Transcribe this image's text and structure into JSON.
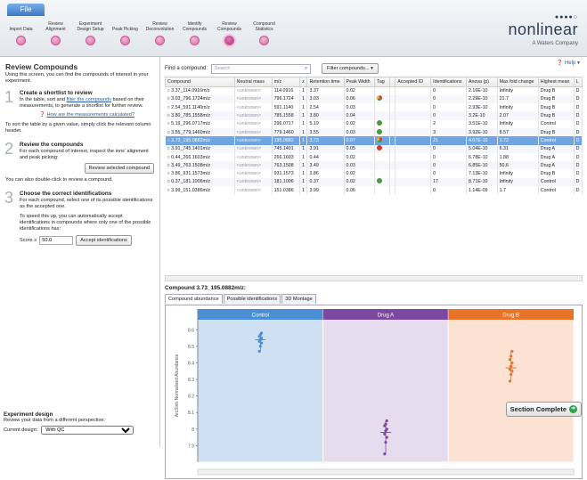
{
  "file_tab": "File",
  "steps": [
    {
      "label": "Import Data",
      "active": false
    },
    {
      "label": "Review Alignment",
      "active": false
    },
    {
      "label": "Experiment Design Setup",
      "active": false
    },
    {
      "label": "Peak Picking",
      "active": false
    },
    {
      "label": "Review Deconvolution",
      "active": false
    },
    {
      "label": "Identify Compounds",
      "active": false
    },
    {
      "label": "Review Compounds",
      "active": true
    },
    {
      "label": "Compound Statistics",
      "active": false
    }
  ],
  "logo": {
    "brand": "nonlinear",
    "sub": "A Waters Company"
  },
  "help": "Help",
  "left": {
    "title": "Review Compounds",
    "intro": "Using this screen, you can find the compounds of interest in your experiment.",
    "step1": {
      "num": "1",
      "title": "Create a shortlist to review",
      "t1": "In the table, sort and ",
      "link": "filter the compounds",
      "t2": " based on their measurements, to generate a shortlist for further review.",
      "question": "How are the measurements calculated?",
      "sort": "To sort the table by a given value, simply click the relevant column header."
    },
    "step2": {
      "num": "2",
      "title": "Review the compounds",
      "text": "For each compound of interest, inspect the ions' alignment and peak picking:",
      "button": "Review selected compound",
      "dbl": "You can also double-click to review a compound."
    },
    "step3": {
      "num": "3",
      "title": "Choose the correct identifications",
      "text": "For each compound, select one of its possible identifications as the accepted one.",
      "speed": "To speed this up, you can automatically accept identifications in compounds where only one of the possible identifications has:",
      "score_label": "Score ≥",
      "score_value": "50.0",
      "accept_button": "Accept identifications"
    },
    "design": {
      "title": "Experiment design",
      "text": "Review your data from a different perspective:",
      "label": "Current design:",
      "value": "With QC"
    }
  },
  "toolbar": {
    "find_label": "Find a compound:",
    "search_placeholder": "Search",
    "filter_button": "Filter compounds..."
  },
  "table": {
    "headers": [
      "Compound",
      "Neutral mass",
      "m/z",
      "z",
      "Retention time",
      "Peak Width",
      "Tag",
      "",
      "Accepted ID",
      "Identifications",
      "Anova (p)",
      "Max fold change",
      "Highest mean",
      "L"
    ],
    "rows": [
      [
        "3.37_114.0916m/z",
        "<unknown>",
        "114.0916",
        "1",
        "3.37",
        "0.02",
        "",
        "",
        "",
        "0",
        "2.16E-10",
        "Infinity",
        "Drug B",
        "D"
      ],
      [
        "3.03_796.1724m/z",
        "<unknown>",
        "796.1724",
        "1",
        "3.03",
        "0.06",
        "multi",
        "",
        "",
        "0",
        "2.29E-10",
        "21.7",
        "Drug B",
        "D"
      ],
      [
        "2.54_591.1140m/z",
        "<unknown>",
        "591.1140",
        "1",
        "2.54",
        "0.03",
        "",
        "",
        "",
        "0",
        "2.93E-10",
        "Infinity",
        "Drug B",
        "D"
      ],
      [
        "3.80_785.1558m/z",
        "<unknown>",
        "785.1558",
        "1",
        "3.80",
        "0.04",
        "",
        "",
        "",
        "0",
        "3.2E-10",
        "2.07",
        "Drug B",
        "D"
      ],
      [
        "5.19_296.0717m/z",
        "<unknown>",
        "296.0717",
        "1",
        "5.19",
        "0.02",
        "green",
        "",
        "",
        "2",
        "3.51E-10",
        "Infinity",
        "Control",
        "D"
      ],
      [
        "3.55_779.1460m/z",
        "<unknown>",
        "779.1460",
        "1",
        "3.55",
        "0.03",
        "green",
        "",
        "",
        "3",
        "3.92E-10",
        "8.57",
        "Drug B",
        "D"
      ],
      [
        "3.73_195.0882m/z",
        "<unknown>",
        "195.0882",
        "1",
        "3.73",
        "0.07",
        "multi",
        "",
        "",
        "21",
        "4.07E-10",
        "1.72",
        "Control",
        "D"
      ],
      [
        "3.91_745.1401m/z",
        "<unknown>",
        "745.1401",
        "1",
        "3.91",
        "0.05",
        "red",
        "",
        "",
        "0",
        "5.04E-10",
        "6.31",
        "Drug A",
        "D"
      ],
      [
        "0.44_266.1603m/z",
        "<unknown>",
        "266.1603",
        "1",
        "0.44",
        "0.02",
        "",
        "",
        "",
        "0",
        "6.78E-10",
        "1.88",
        "Drug A",
        "D"
      ],
      [
        "3.49_763.1508m/z",
        "<unknown>",
        "763.1508",
        "1",
        "3.49",
        "0.03",
        "",
        "",
        "",
        "0",
        "6.85E-10",
        "50.6",
        "Drug A",
        "D"
      ],
      [
        "3.86_931.1573m/z",
        "<unknown>",
        "931.1573",
        "1",
        "3.86",
        "0.02",
        "",
        "",
        "",
        "0",
        "7.13E-10",
        "Infinity",
        "Drug B",
        "D"
      ],
      [
        "0.37_181.1006m/z",
        "<unknown>",
        "181.1006",
        "1",
        "0.37",
        "0.02",
        "green",
        "",
        "",
        "17",
        "8.71E-10",
        "Infinity",
        "Control",
        "D"
      ],
      [
        "3.99_151.0386m/z",
        "<unknown>",
        "151.0386",
        "1",
        "3.99",
        "0.06",
        "",
        "",
        "",
        "0",
        "1.14E-09",
        "1.7",
        "Control",
        "D"
      ]
    ],
    "selected_index": 6
  },
  "detail": {
    "title": "Compound 3.73_195.0882m/z:",
    "tabs": [
      "Compound abundance",
      "Possible identifications",
      "3D Montage"
    ]
  },
  "colors": {
    "control": "#4a8fd3",
    "druga": "#7b4aa0",
    "drugb": "#e8742a",
    "selected": "#6fa5e0",
    "tag_red": "#d93a2b",
    "tag_green": "#4a9a3a"
  },
  "chart_data": {
    "type": "scatter",
    "ylabel": "ArcSinh Normalised Abundance",
    "ylim": [
      7.8,
      8.65
    ],
    "yticks": [
      7.9,
      8.0,
      8.1,
      8.2,
      8.3,
      8.4,
      8.5,
      8.6
    ],
    "groups": [
      {
        "name": "Control",
        "values": [
          8.47,
          8.5,
          8.52,
          8.53,
          8.54,
          8.55,
          8.56,
          8.57,
          8.58
        ],
        "mean": 8.54
      },
      {
        "name": "Drug A",
        "values": [
          7.85,
          7.92,
          7.95,
          7.97,
          7.99,
          8.0,
          8.02,
          8.03,
          8.05
        ],
        "mean": 7.98
      },
      {
        "name": "Drug B",
        "values": [
          8.29,
          8.33,
          8.35,
          8.36,
          8.38,
          8.4,
          8.42,
          8.44,
          8.47
        ],
        "mean": 8.37
      }
    ]
  },
  "complete_button": "Section Complete"
}
